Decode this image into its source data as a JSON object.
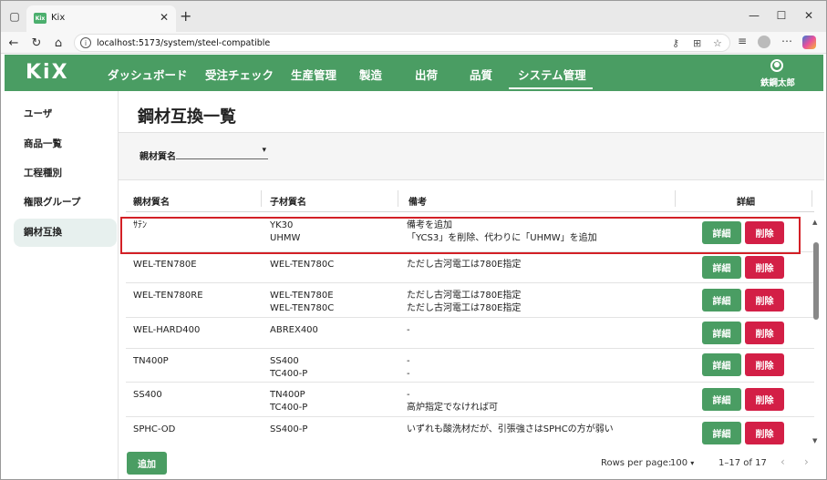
{
  "browser": {
    "tab_title": "Kix",
    "tab_icon_text": "Kix",
    "url": "localhost:5173/system/steel-compatible"
  },
  "app": {
    "logo": "KiX",
    "nav": [
      {
        "label": "ダッシュボード"
      },
      {
        "label": "受注チェック"
      },
      {
        "label": "生産管理"
      },
      {
        "label": "製造"
      },
      {
        "label": "出荷"
      },
      {
        "label": "品質"
      },
      {
        "label": "システム管理"
      }
    ],
    "active_nav": "システム管理",
    "user_name": "鉄鋼太郎"
  },
  "sidebar": {
    "items": [
      {
        "label": "ユーザ"
      },
      {
        "label": "商品一覧"
      },
      {
        "label": "工程種別"
      },
      {
        "label": "権限グループ"
      },
      {
        "label": "鋼材互換"
      }
    ],
    "active": "鋼材互換"
  },
  "page": {
    "title": "鋼材互換一覧",
    "filter_label": "親材質名",
    "filter_value": ""
  },
  "table": {
    "headers": [
      "親材質名",
      "子材質名",
      "備考",
      "詳細"
    ],
    "detail_label": "詳細",
    "delete_label": "削除",
    "rows": [
      {
        "parent": "ｻﾃﾝ",
        "children": [
          "YK30",
          "UHMW"
        ],
        "notes": [
          "備考を追加",
          "「YCS3」を削除、代わりに「UHMW」を追加"
        ]
      },
      {
        "parent": "WEL-TEN780E",
        "children": [
          "WEL-TEN780C"
        ],
        "notes": [
          "ただし古河電工は780E指定"
        ]
      },
      {
        "parent": "WEL-TEN780RE",
        "children": [
          "WEL-TEN780E",
          "WEL-TEN780C"
        ],
        "notes": [
          "ただし古河電工は780E指定",
          "ただし古河電工は780E指定"
        ]
      },
      {
        "parent": "WEL-HARD400",
        "children": [
          "ABREX400"
        ],
        "notes": [
          "-"
        ]
      },
      {
        "parent": "TN400P",
        "children": [
          "SS400",
          "TC400-P"
        ],
        "notes": [
          "-",
          "-"
        ]
      },
      {
        "parent": "SS400",
        "children": [
          "TN400P",
          "TC400-P"
        ],
        "notes": [
          "-",
          "高炉指定でなければ可"
        ]
      },
      {
        "parent": "SPHC-OD",
        "children": [
          "SS400-P"
        ],
        "notes": [
          "いずれも酸洗材だが、引張強さはSPHCの方が弱い"
        ]
      }
    ]
  },
  "footer": {
    "add_label": "追加",
    "rows_per_page_label": "Rows per page:",
    "rows_per_page_value": "100",
    "range_text": "1–17 of 17"
  },
  "colors": {
    "brand_green": "#4a9d63",
    "delete_red": "#d31f46",
    "highlight_red": "#d32026"
  }
}
